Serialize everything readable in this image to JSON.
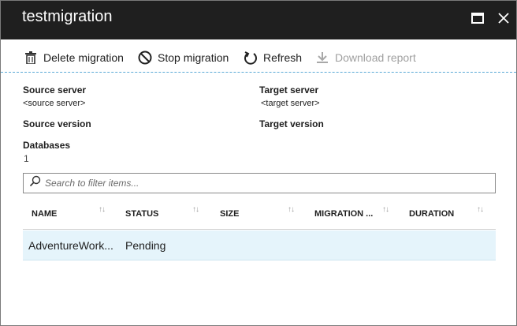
{
  "window": {
    "title": "testmigration",
    "maximize_icon": "maximize-icon",
    "close_icon": "close-icon"
  },
  "toolbar": {
    "delete_label": "Delete migration",
    "stop_label": "Stop migration",
    "refresh_label": "Refresh",
    "download_label": "Download report"
  },
  "properties": {
    "source_server_label": "Source server",
    "source_server_value": "<source server>",
    "target_server_label": "Target server",
    "target_server_value": "<target server>",
    "source_version_label": "Source version",
    "target_version_label": "Target version",
    "databases_label": "Databases",
    "databases_value": "1"
  },
  "search": {
    "placeholder": "Search to filter items..."
  },
  "table": {
    "columns": [
      "NAME",
      "STATUS",
      "SIZE",
      "MIGRATION ...",
      "DURATION"
    ],
    "sort_glyph": "↑↓",
    "rows": [
      {
        "name": "AdventureWork...",
        "status": "Pending",
        "size": "",
        "migration": "",
        "duration": ""
      }
    ]
  },
  "colors": {
    "titlebar": "#1f1f1f",
    "selected_row": "#e5f4fb",
    "accent_dashed": "#5aa9d6"
  }
}
